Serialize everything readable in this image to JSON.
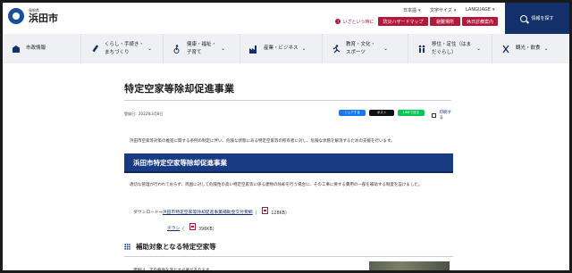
{
  "header": {
    "logo_sub": "島根県",
    "logo_main": "浜田市",
    "util": {
      "jp": "日本語",
      "size": "文字サイズ",
      "lang": "LANGUAGE"
    },
    "emergency": "いざという時に",
    "emergency_icon": "!",
    "hazard_map": "防災ハザードマップ",
    "shelter": "避難場所",
    "open_holiday": "休日診療案内",
    "search": "情報を探す"
  },
  "nav": [
    {
      "label": "市政情報",
      "icon": "city-hall-icon"
    },
    {
      "label": "くらし・手続き・まちづくり",
      "icon": "pen-icon"
    },
    {
      "label": "健康・福祉・子育て",
      "icon": "wheelchair-icon"
    },
    {
      "label": "産業・ビジネス",
      "icon": "factory-icon"
    },
    {
      "label": "教育・文化・スポーツ",
      "icon": "runner-icon"
    },
    {
      "label": "移住・定住（はまだぐらし）",
      "icon": "family-icon"
    },
    {
      "label": "観光・飲食",
      "icon": "utensils-icon"
    }
  ],
  "page": {
    "title": "特定空家等除却促進事業",
    "reg_date": "登録日：2022年3月8日",
    "share_fb": "シェアする",
    "share_x": "ポスト",
    "share_line": "LINEで送る",
    "print": "印刷する",
    "intro": "浜田市空家等対策の推進に関する条例の制定に伴い、危険な状態にある特定空家等の所有者に対し、危険な状態を解消するための支援を行います。",
    "section_title": "浜田市特定空家等除却促進事業",
    "body1": "適切な管理が行われておらず、周囲に対して危険性の高い特定空家等に係る建物の除却を行う場合に、その工事に要する費用の一部を補助する制度を設けました。",
    "download_prefix": "ダウンロード⇒",
    "download_link": "浜田市特定空家等除却促進事業補助金交付要綱",
    "download_size": "128KB",
    "flyer_link": "チラシ",
    "flyer_size": "396KB",
    "sub_title": "補助対象となる特定空家等",
    "body2": "建物は、次の要件を満たす必要があります。"
  },
  "colors": {
    "navy": "#13306b",
    "banner": "#183b84",
    "red": "#b0193a"
  }
}
